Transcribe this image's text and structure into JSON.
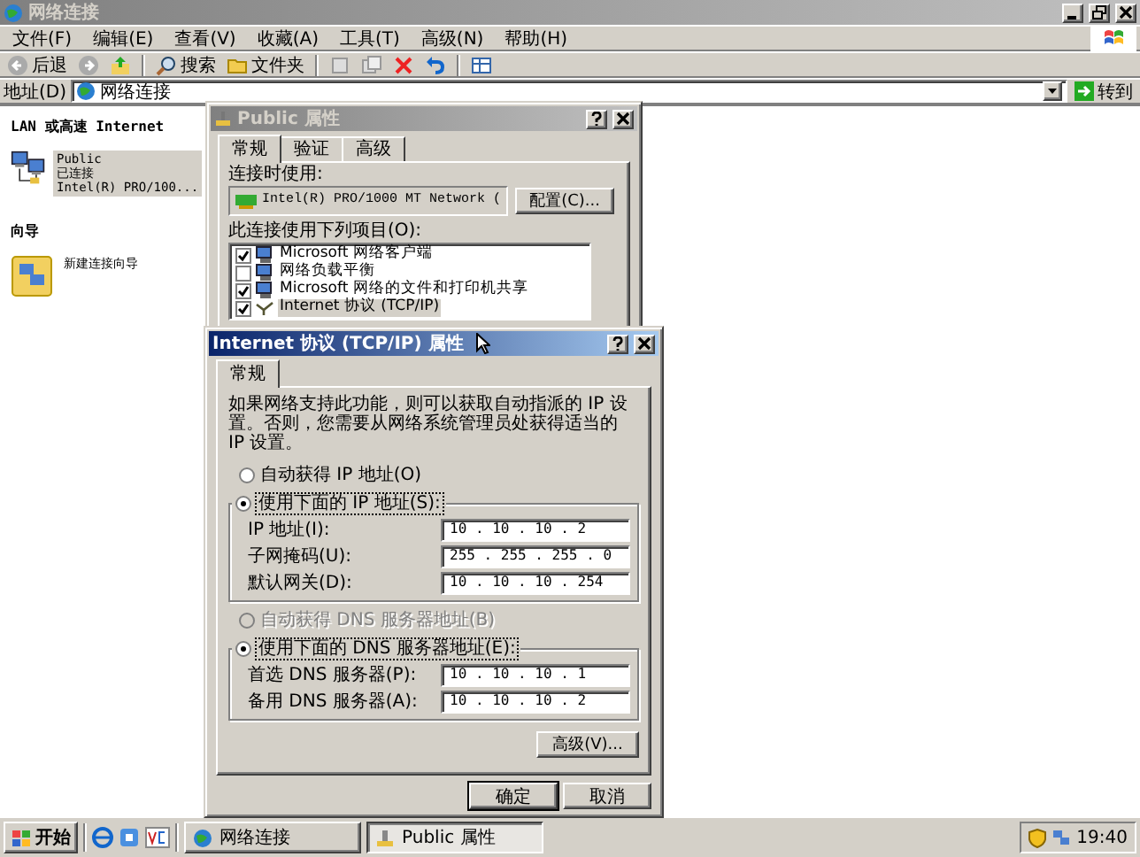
{
  "explorer": {
    "title": "网络连接",
    "active": false,
    "menu": [
      "文件(F)",
      "编辑(E)",
      "查看(V)",
      "收藏(A)",
      "工具(T)",
      "高级(N)",
      "帮助(H)"
    ],
    "toolbar": [
      {
        "kind": "back",
        "label": "后退"
      },
      {
        "kind": "forward"
      },
      {
        "kind": "up"
      },
      {
        "kind": "search",
        "label": "搜索"
      },
      {
        "kind": "folders",
        "label": "文件夹"
      },
      {
        "kind": "move"
      },
      {
        "kind": "copy"
      },
      {
        "kind": "delete"
      },
      {
        "kind": "undo"
      },
      {
        "kind": "views"
      }
    ],
    "address": {
      "label": "地址(D)",
      "value": "网络连接",
      "go": "转到"
    },
    "left_pane": {
      "sections": [
        {
          "heading": "LAN 或高速 Internet",
          "items": [
            {
              "kind": "lan",
              "lines": [
                "Public",
                "已连接",
                "Intel(R) PRO/100..."
              ],
              "selected": true
            }
          ]
        },
        {
          "heading": "向导",
          "items": [
            {
              "kind": "wizard",
              "lines": [
                "新建连接向导"
              ],
              "selected": false
            }
          ]
        }
      ]
    }
  },
  "public_dialog": {
    "title": "Public 属性",
    "active": false,
    "tabs": [
      {
        "label": "常规",
        "selected": true
      },
      {
        "label": "验证",
        "selected": false
      },
      {
        "label": "高级",
        "selected": false
      }
    ],
    "connect_using_label": "连接时使用:",
    "adapter": "Intel(R) PRO/1000 MT Network (",
    "configure_button": "配置(C)...",
    "items_label": "此连接使用下列项目(O):",
    "items": [
      {
        "kind": "client",
        "label": "Microsoft 网络客户端",
        "checked": true,
        "selected": false
      },
      {
        "kind": "client",
        "label": "网络负载平衡",
        "checked": false,
        "selected": false
      },
      {
        "kind": "client",
        "label": "Microsoft 网络的文件和打印机共享",
        "checked": true,
        "selected": false
      },
      {
        "kind": "protocol",
        "label": "Internet 协议 (TCP/IP)",
        "checked": true,
        "selected": true
      }
    ]
  },
  "tcpip_dialog": {
    "title": "Internet 协议 (TCP/IP) 属性",
    "active": true,
    "tabs": [
      {
        "label": "常规",
        "selected": true
      }
    ],
    "description": "如果网络支持此功能，则可以获取自动指派的 IP 设置。否则，您需要从网络系统管理员处获得适当的 IP 设置。",
    "ip_options": [
      {
        "label": "自动获得 IP 地址(O)",
        "selected": false,
        "disabled": false
      },
      {
        "label": "使用下面的 IP 地址(S):",
        "selected": true,
        "disabled": false
      }
    ],
    "ip_fields": [
      {
        "label": "IP 地址(I):",
        "value": "10 . 10 . 10 . 2"
      },
      {
        "label": "子网掩码(U):",
        "value": "255 . 255 . 255 . 0"
      },
      {
        "label": "默认网关(D):",
        "value": "10 . 10 . 10 . 254"
      }
    ],
    "dns_options": [
      {
        "label": "自动获得 DNS 服务器地址(B)",
        "selected": false,
        "disabled": true
      },
      {
        "label": "使用下面的 DNS 服务器地址(E):",
        "selected": true,
        "disabled": false
      }
    ],
    "dns_fields": [
      {
        "label": "首选 DNS 服务器(P):",
        "value": "10 . 10 . 10 . 1"
      },
      {
        "label": "备用 DNS 服务器(A):",
        "value": "10 . 10 . 10 . 2"
      }
    ],
    "advanced_button": "高级(V)...",
    "buttons": [
      "确定",
      "取消"
    ]
  },
  "taskbar": {
    "start": "开始",
    "tasks": [
      {
        "kind": "network",
        "label": "网络连接",
        "selected": false
      },
      {
        "kind": "properties",
        "label": "Public 属性",
        "selected": true
      }
    ],
    "clock": "19:40"
  }
}
